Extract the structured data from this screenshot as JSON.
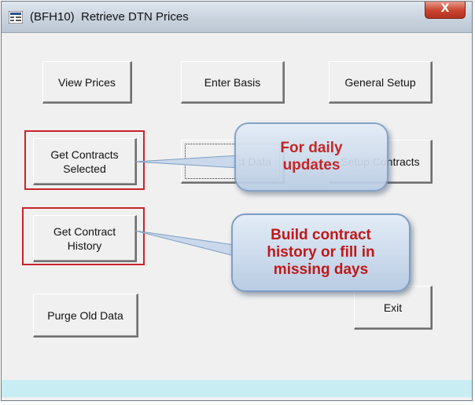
{
  "window": {
    "title": "(BFH10)  Retrieve DTN Prices",
    "close_label": "X"
  },
  "buttons": {
    "view_prices": "View Prices",
    "enter_basis": "Enter Basis",
    "general_setup": "General Setup",
    "get_contracts_selected": "Get Contracts\nSelected",
    "get_select_data": "Get Select Data",
    "setup_contracts": "Setup Contracts",
    "get_contract_history": "Get Contract\nHistory",
    "purge_old_data": "Purge Old Data",
    "exit": "Exit"
  },
  "callouts": {
    "daily": "For daily\nupdates",
    "history": "Build contract\nhistory or fill in\nmissing days"
  },
  "colors": {
    "callout_text": "#c01818",
    "highlight_box": "#c8242a",
    "status_strip": "#c8eef4"
  }
}
